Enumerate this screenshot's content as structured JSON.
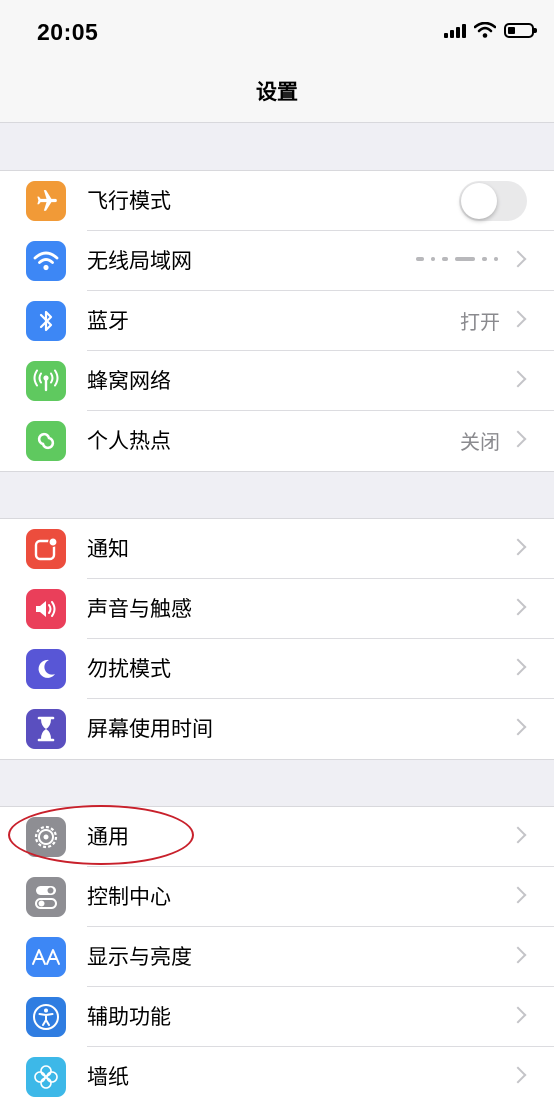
{
  "status_bar": {
    "time": "20:05"
  },
  "nav": {
    "title": "设置"
  },
  "groups": [
    {
      "rows": [
        {
          "label": "飞行模式",
          "icon": "airplane-icon",
          "icon_color": "#f19a37",
          "control": "toggle",
          "toggle_on": false
        },
        {
          "label": "无线局域网",
          "icon": "wifi-icon",
          "icon_color": "#3d87f5",
          "value_redacted": true
        },
        {
          "label": "蓝牙",
          "icon": "bluetooth-icon",
          "icon_color": "#3d87f5",
          "value": "打开"
        },
        {
          "label": "蜂窝网络",
          "icon": "antenna-icon",
          "icon_color": "#5fc95f"
        },
        {
          "label": "个人热点",
          "icon": "hotspot-icon",
          "icon_color": "#5fc95f",
          "value": "关闭"
        }
      ]
    },
    {
      "rows": [
        {
          "label": "通知",
          "icon": "notifications-icon",
          "icon_color": "#ec4d3d"
        },
        {
          "label": "声音与触感",
          "icon": "speaker-icon",
          "icon_color": "#ea3f5a"
        },
        {
          "label": "勿扰模式",
          "icon": "moon-icon",
          "icon_color": "#5856d6"
        },
        {
          "label": "屏幕使用时间",
          "icon": "hourglass-icon",
          "icon_color": "#5a4fbf"
        }
      ]
    },
    {
      "rows": [
        {
          "label": "通用",
          "icon": "gear-icon",
          "icon_color": "#8e8e93"
        },
        {
          "label": "控制中心",
          "icon": "switches-icon",
          "icon_color": "#8e8e93"
        },
        {
          "label": "显示与亮度",
          "icon": "text-size-icon",
          "icon_color": "#3d87f5"
        },
        {
          "label": "辅助功能",
          "icon": "accessibility-icon",
          "icon_color": "#2f7de1"
        },
        {
          "label": "墙纸",
          "icon": "flower-icon",
          "icon_color": "#3db8e8"
        }
      ]
    }
  ]
}
